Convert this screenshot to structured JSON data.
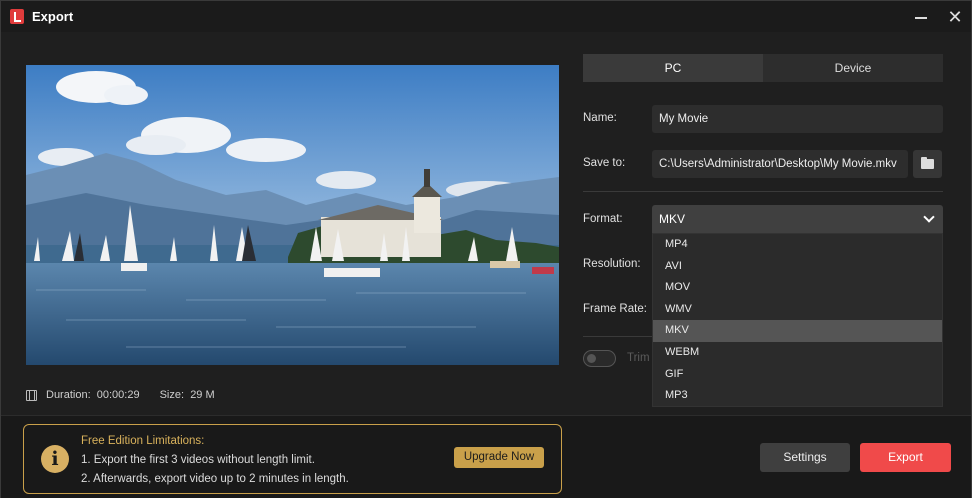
{
  "window": {
    "title": "Export"
  },
  "preview": {
    "duration_label": "Duration:",
    "duration": "00:00:29",
    "size_label": "Size:",
    "size": "29 M"
  },
  "tabs": [
    {
      "label": "PC",
      "active": true
    },
    {
      "label": "Device",
      "active": false
    }
  ],
  "form": {
    "name_label": "Name:",
    "name_value": "My Movie",
    "save_label": "Save to:",
    "save_value": "C:\\Users\\Administrator\\Desktop\\My Movie.mkv",
    "format_label": "Format:",
    "format_value": "MKV",
    "resolution_label": "Resolution:",
    "framerate_label": "Frame Rate:",
    "trim_label": "Trim"
  },
  "format_options": [
    "MP4",
    "AVI",
    "MOV",
    "WMV",
    "MKV",
    "WEBM",
    "GIF",
    "MP3"
  ],
  "selected_format_index": 4,
  "limits": {
    "title": "Free Edition Limitations:",
    "line1": "1. Export the first 3 videos without length limit.",
    "line2": "2. Afterwards, export video up to 2 minutes in length.",
    "upgrade_label": "Upgrade Now"
  },
  "buttons": {
    "settings_label": "Settings",
    "export_label": "Export"
  },
  "colors": {
    "accent": "#f04a4a",
    "gold": "#c9a04a",
    "bg": "#1f1f1f"
  }
}
